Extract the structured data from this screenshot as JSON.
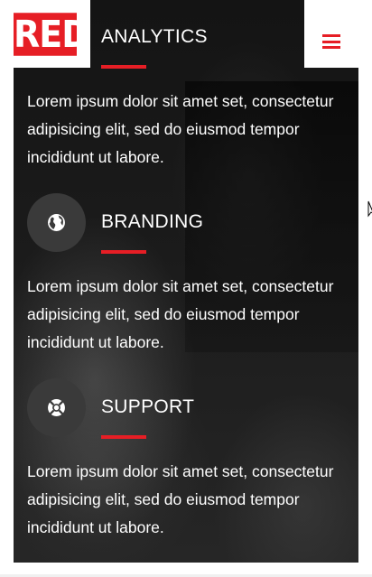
{
  "brand": {
    "logo_text": "RED",
    "accent_color": "#e61e25"
  },
  "header": {
    "menu_icon": "hamburger-menu-icon"
  },
  "sections": [
    {
      "title": "ANALYTICS",
      "text": "Lorem ipsum dolor sit amet set, consectetur adipisicing elit, sed do eiusmod tempor incididunt ut labore."
    },
    {
      "title": "BRANDING",
      "icon": "globe-icon",
      "text": "Lorem ipsum dolor sit amet set, consectetur adipisicing elit, sed do eiusmod tempor incididunt ut labore."
    },
    {
      "title": "SUPPORT",
      "icon": "lifebuoy-icon",
      "text": "Lorem ipsum dolor sit amet set, consectetur adipisicing elit, sed do eiusmod tempor incididunt ut labore."
    }
  ]
}
